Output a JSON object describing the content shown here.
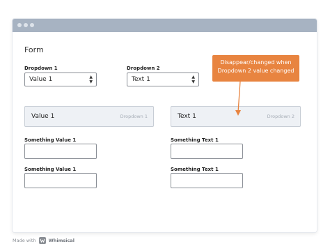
{
  "form": {
    "title": "Form",
    "dropdown1": {
      "label": "Dropdown 1",
      "value": "Value 1"
    },
    "dropdown2": {
      "label": "Dropdown 2",
      "value": "Text 1"
    },
    "panel1": {
      "value": "Value 1",
      "tag": "Dropdown 1"
    },
    "panel2": {
      "value": "Text 1",
      "tag": "Dropdown 2"
    },
    "left_fields": [
      {
        "label": "Something Value 1",
        "value": ""
      },
      {
        "label": "Something Value 1",
        "value": ""
      }
    ],
    "right_fields": [
      {
        "label": "Something Text 1",
        "value": ""
      },
      {
        "label": "Something Text 1",
        "value": ""
      }
    ]
  },
  "annotation": {
    "line1": "Disappear/changed when",
    "line2": "Dropdown 2 value changed",
    "color": "#e88440"
  },
  "footer": {
    "made_with": "Made with",
    "brand": "Whimsical"
  }
}
